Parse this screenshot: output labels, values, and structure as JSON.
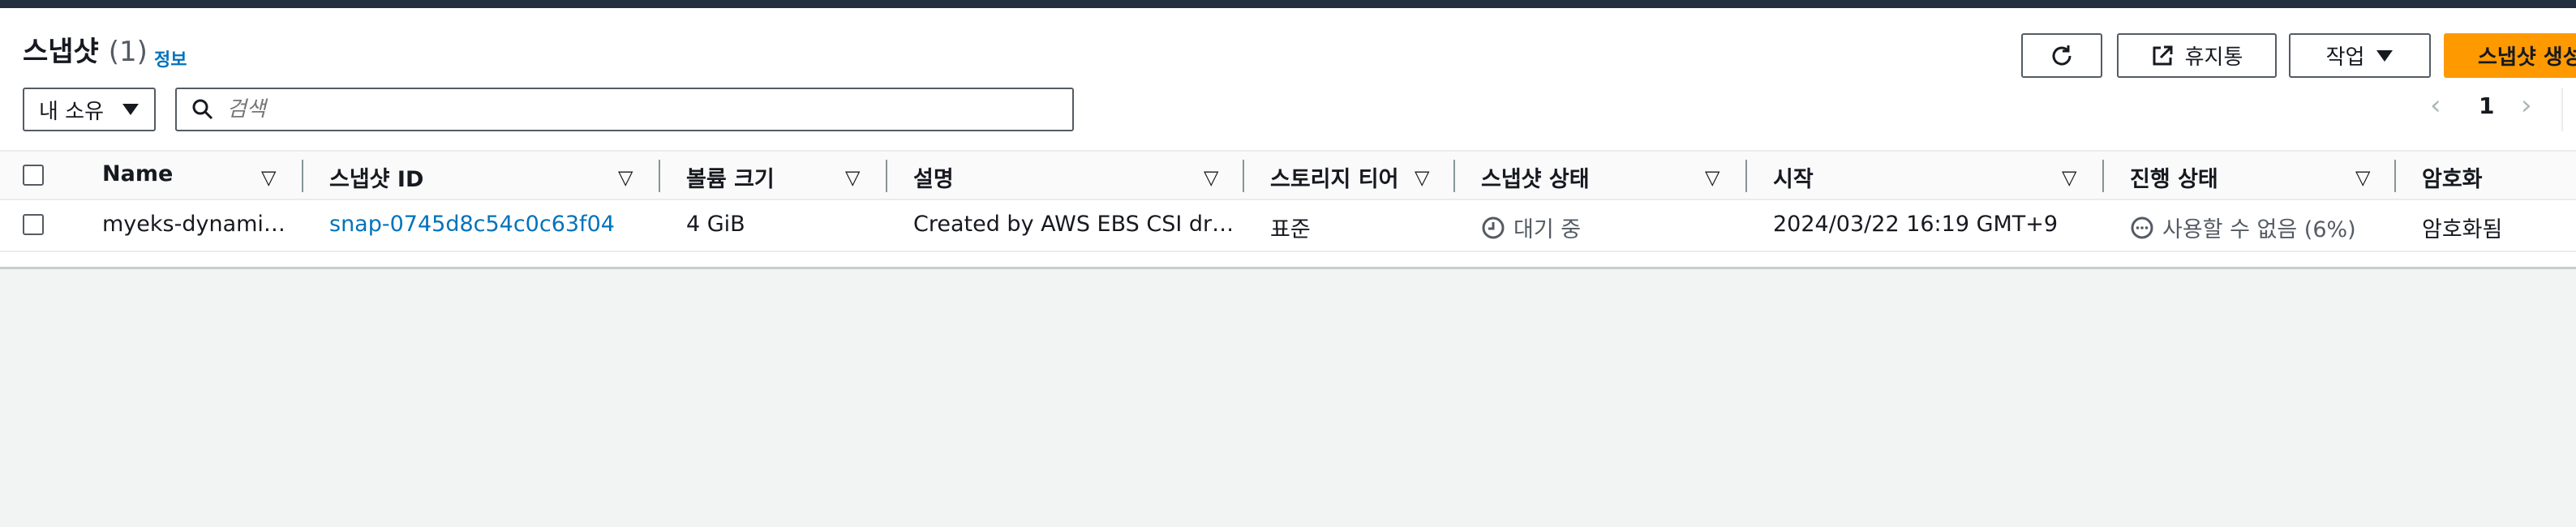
{
  "header": {
    "title": "스냅샷",
    "count": "(1)",
    "info": "정보"
  },
  "toolbar": {
    "recycle_label": "휴지통",
    "actions_label": "작업",
    "create_label": "스냅샷 생성"
  },
  "filter": {
    "owner_value": "내 소유",
    "search_placeholder": "검색"
  },
  "pagination": {
    "current_page": "1"
  },
  "table": {
    "columns": [
      "Name",
      "스냅샷 ID",
      "볼륨 크기",
      "설명",
      "스토리지 티어",
      "스냅샷 상태",
      "시작",
      "진행 상태",
      "암호화"
    ],
    "rows": [
      {
        "name": "myeks-dynami…",
        "snapshot_id": "snap-0745d8c54c0c63f04",
        "volume_size": "4 GiB",
        "description": "Created by AWS EBS CSI dr…",
        "storage_tier": "표준",
        "state": "대기 중",
        "started": "2024/03/22 16:19 GMT+9",
        "progress": "사용할 수 없음 (6%)",
        "encryption": "암호화됨"
      }
    ]
  },
  "colors": {
    "topbar": "#232f3e",
    "link": "#0073bb",
    "primary_button": "#ff9900"
  }
}
